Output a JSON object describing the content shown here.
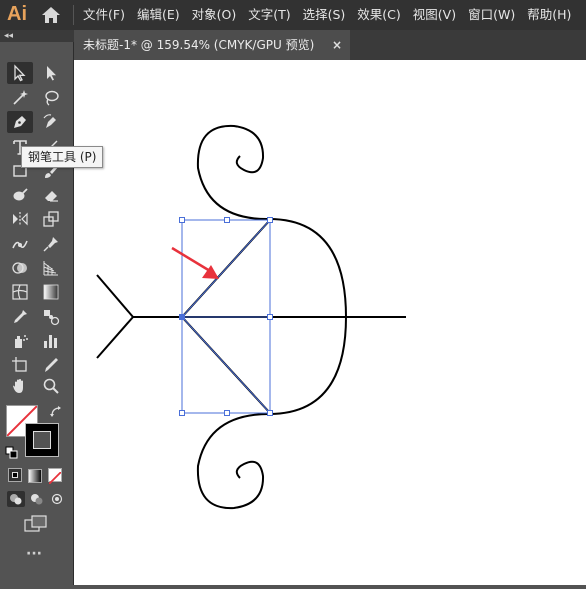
{
  "app": {
    "logo": "Ai"
  },
  "menu": {
    "items": [
      "文件(F)",
      "编辑(E)",
      "对象(O)",
      "文字(T)",
      "选择(S)",
      "效果(C)",
      "视图(V)",
      "窗口(W)",
      "帮助(H)"
    ]
  },
  "document": {
    "tab_title": "未标题-1* @ 159.54% (CMYK/GPU 预览)",
    "close_glyph": "×"
  },
  "tooltip": {
    "text": "钢笔工具 (P)"
  },
  "toolbar": {
    "more_glyph": "···",
    "collapse_glyph": "◂◂",
    "tools": [
      "selection-tool",
      "direct-selection-tool",
      "magic-wand-tool",
      "lasso-tool",
      "pen-tool",
      "curvature-tool",
      "type-tool",
      "line-tool",
      "rectangle-tool",
      "paintbrush-tool",
      "shaper-tool",
      "eraser-tool",
      "rotate-tool",
      "scale-tool",
      "width-tool",
      "free-transform-tool",
      "puppet-warp-tool",
      "shape-builder-tool",
      "perspective-grid-tool",
      "mesh-tool",
      "gradient-tool",
      "eyedropper-tool",
      "blend-tool",
      "symbol-sprayer-tool",
      "column-graph-tool",
      "artboard-tool",
      "slice-tool",
      "hand-tool",
      "zoom-tool"
    ]
  },
  "colors": {
    "menubar": "#323232",
    "panel": "#535353",
    "canvas": "#ffffff",
    "selection": "#4a6fd8",
    "arrow": "#e8323c",
    "logo": "#e8a35c"
  }
}
